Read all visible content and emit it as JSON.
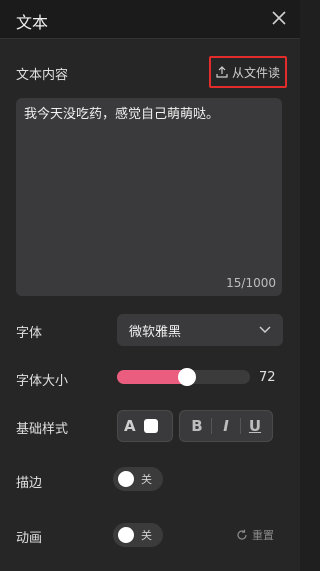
{
  "header": {
    "title": "文本"
  },
  "content": {
    "label": "文本内容",
    "upload_label": "从文件读",
    "text": "我今天没吃药，感觉自己萌萌哒。",
    "counter": "15/1000"
  },
  "font": {
    "label": "字体",
    "value": "微软雅黑"
  },
  "font_size": {
    "label": "字体大小",
    "value": "72",
    "level": 0.53
  },
  "base_style": {
    "label": "基础样式",
    "font_color_letter": "A",
    "bold": "B",
    "italic": "I",
    "underline": "U",
    "swatch_color": "#ffffff"
  },
  "stroke": {
    "label": "描边",
    "state": "关"
  },
  "animation": {
    "label": "动画",
    "state": "关",
    "reset_label": "重置"
  },
  "colors": {
    "accent": "#ea5d7f",
    "highlight": "#e32c2c",
    "bg": "#262626"
  }
}
